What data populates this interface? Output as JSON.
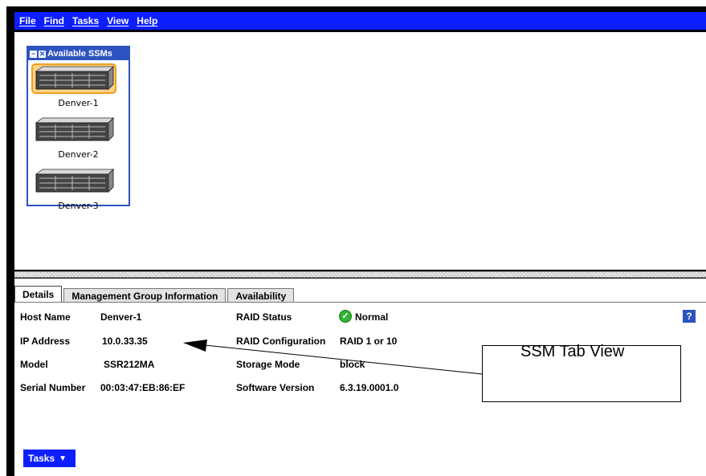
{
  "menu": {
    "items": [
      "File",
      "Find",
      "Tasks",
      "View",
      "Help"
    ]
  },
  "ssm_panel": {
    "title": "Available SSMs",
    "items": [
      {
        "label": "Denver-1",
        "selected": true
      },
      {
        "label": "Denver-2",
        "selected": false
      },
      {
        "label": "Denver-3",
        "selected": false
      }
    ]
  },
  "tabs": [
    {
      "label": "Details",
      "active": true
    },
    {
      "label": "Management Group Information",
      "active": false
    },
    {
      "label": "Availability",
      "active": false
    }
  ],
  "details": {
    "host_name_label": "Host Name",
    "host_name_value": "Denver-1",
    "ip_label": "IP Address",
    "ip_value": "10.0.33.35",
    "model_label": "Model",
    "model_value": "SSR212MA",
    "serial_label": "Serial Number",
    "serial_value": "00:03:47:EB:86:EF",
    "raid_status_label": "RAID Status",
    "raid_status_value": "Normal",
    "raid_config_label": "RAID Configuration",
    "raid_config_value": "RAID 1 or 10",
    "storage_mode_label": "Storage Mode",
    "storage_mode_value": "block",
    "software_label": "Software Version",
    "software_value": "6.3.19.0001.0"
  },
  "help_icon": "?",
  "tasks_button": {
    "label": "Tasks",
    "icon": "dropdown-arrow-icon"
  },
  "callout": {
    "text": "SSM Tab View"
  },
  "colors": {
    "menubar": "#0d1fff",
    "panel_blue": "#2d53c0",
    "status_green": "#2fb52f"
  }
}
